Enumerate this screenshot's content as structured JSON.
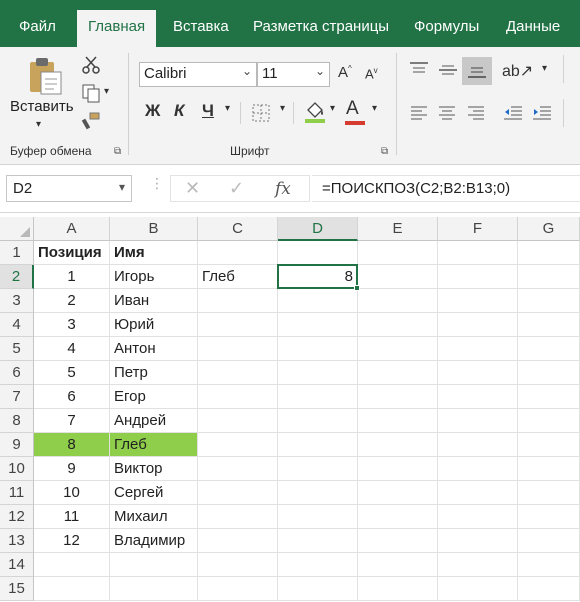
{
  "ribbon_tabs": [
    "Файл",
    "Главная",
    "Вставка",
    "Разметка страницы",
    "Формулы",
    "Данные"
  ],
  "active_tab": "Главная",
  "clipboard": {
    "paste_label": "Вставить",
    "group_label": "Буфер обмена"
  },
  "font": {
    "name": "Calibri",
    "size": "11",
    "group_label": "Шрифт",
    "bold": "Ж",
    "italic": "К",
    "underline": "Ч",
    "grow": "A",
    "shrink": "A",
    "color_letter": "A"
  },
  "accent_color": "#217346",
  "highlight_color": "#8fce4a",
  "name_box": "D2",
  "formula": "=ПОИСКПОЗ(C2;B2:B13;0)",
  "fx_label": "fx",
  "columns": [
    "A",
    "B",
    "C",
    "D",
    "E",
    "F",
    "G"
  ],
  "selected_column": "D",
  "selected_row": "2",
  "rows": [
    {
      "num": "1",
      "A": "Позиция",
      "B": "Имя",
      "C": "",
      "D": ""
    },
    {
      "num": "2",
      "A": "1",
      "B": "Игорь",
      "C": "Глеб",
      "D": "8"
    },
    {
      "num": "3",
      "A": "2",
      "B": "Иван",
      "C": "",
      "D": ""
    },
    {
      "num": "4",
      "A": "3",
      "B": "Юрий",
      "C": "",
      "D": ""
    },
    {
      "num": "5",
      "A": "4",
      "B": "Антон",
      "C": "",
      "D": ""
    },
    {
      "num": "6",
      "A": "5",
      "B": "Петр",
      "C": "",
      "D": ""
    },
    {
      "num": "7",
      "A": "6",
      "B": "Егор",
      "C": "",
      "D": ""
    },
    {
      "num": "8",
      "A": "7",
      "B": "Андрей",
      "C": "",
      "D": ""
    },
    {
      "num": "9",
      "A": "8",
      "B": "Глеб",
      "C": "",
      "D": ""
    },
    {
      "num": "10",
      "A": "9",
      "B": "Виктор",
      "C": "",
      "D": ""
    },
    {
      "num": "11",
      "A": "10",
      "B": "Сергей",
      "C": "",
      "D": ""
    },
    {
      "num": "12",
      "A": "11",
      "B": "Михаил",
      "C": "",
      "D": ""
    },
    {
      "num": "13",
      "A": "12",
      "B": "Владимир",
      "C": "",
      "D": ""
    },
    {
      "num": "14",
      "A": "",
      "B": "",
      "C": "",
      "D": ""
    },
    {
      "num": "15",
      "A": "",
      "B": "",
      "C": "",
      "D": ""
    }
  ],
  "highlighted_row": "9"
}
